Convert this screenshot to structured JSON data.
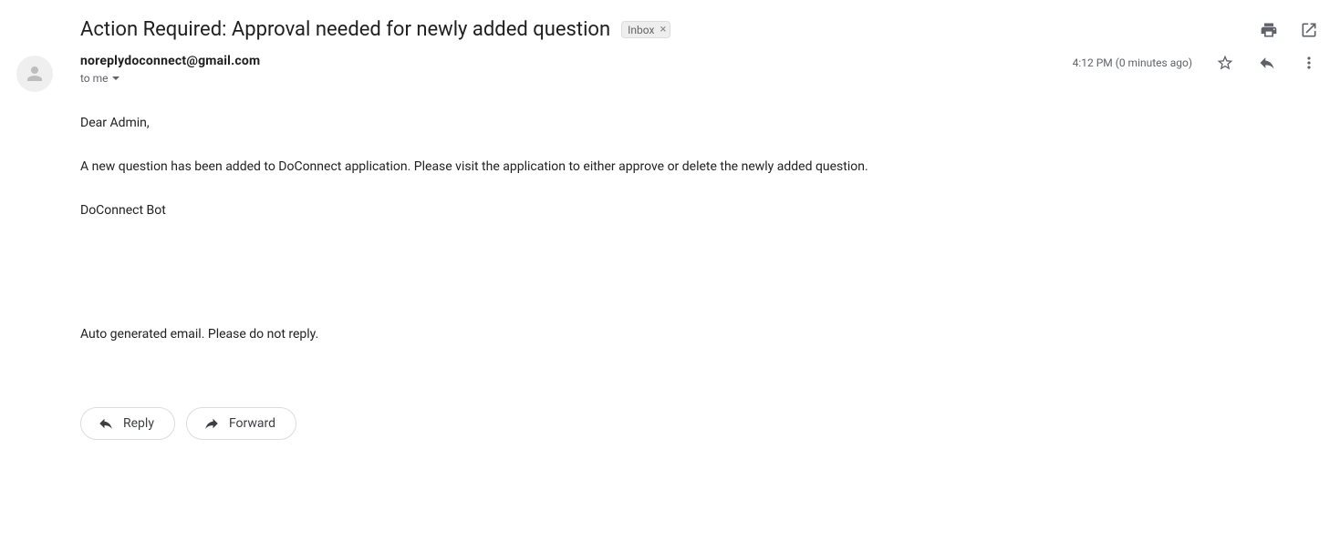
{
  "subject": "Action Required: Approval needed for newly added question",
  "label": {
    "text": "Inbox"
  },
  "sender": "noreplydoconnect@gmail.com",
  "recipient_line": "to me",
  "timestamp": "4:12 PM (0 minutes ago)",
  "body": {
    "greeting": "Dear Admin,",
    "main": "A new question has been added to DoConnect application. Please visit the application to either approve or delete the newly added question.",
    "signature": "DoConnect Bot",
    "footer": "Auto generated email. Please do not reply."
  },
  "actions": {
    "reply": "Reply",
    "forward": "Forward"
  }
}
